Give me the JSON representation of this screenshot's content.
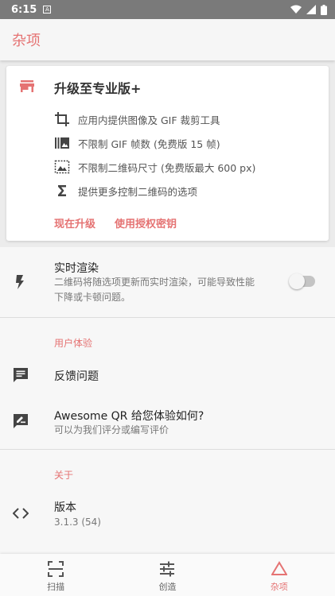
{
  "status_bar": {
    "time": "6:15",
    "notif_letter": "A"
  },
  "app_bar": {
    "title": "杂项"
  },
  "upgrade_card": {
    "title": "升级至专业版+",
    "features": [
      {
        "icon": "crop-icon",
        "text": "应用内提供图像及 GIF 裁剪工具"
      },
      {
        "icon": "gif-frames-icon",
        "text": "不限制 GIF 帧数 (免费版 15 帧)"
      },
      {
        "icon": "image-size-icon",
        "text": "不限制二维码尺寸 (免费版最大 600 px)"
      },
      {
        "icon": "sigma-icon",
        "text": "提供更多控制二维码的选项"
      }
    ],
    "actions": {
      "upgrade_now": "现在升级",
      "use_license_key": "使用授权密钥"
    }
  },
  "realtime_render": {
    "title": "实时渲染",
    "subtitle_line1": "二维码将随选项更新而实时渲染，可能导致性能",
    "subtitle_line2": "下降或卡顿问题。",
    "enabled": false
  },
  "user_experience": {
    "category": "用户体验",
    "feedback": {
      "title": "反馈问题"
    },
    "rate": {
      "title": "Awesome QR 给您体验如何?",
      "subtitle": "可以为我们评分或编写评价"
    }
  },
  "about": {
    "category": "关于",
    "version": {
      "title": "版本",
      "value": "3.1.3 (54)"
    }
  },
  "bottom_nav": {
    "items": [
      {
        "label": "扫描",
        "active": false
      },
      {
        "label": "创造",
        "active": false
      },
      {
        "label": "杂项",
        "active": true
      }
    ]
  },
  "colors": {
    "accent": "#e57373",
    "background": "#ececec"
  }
}
